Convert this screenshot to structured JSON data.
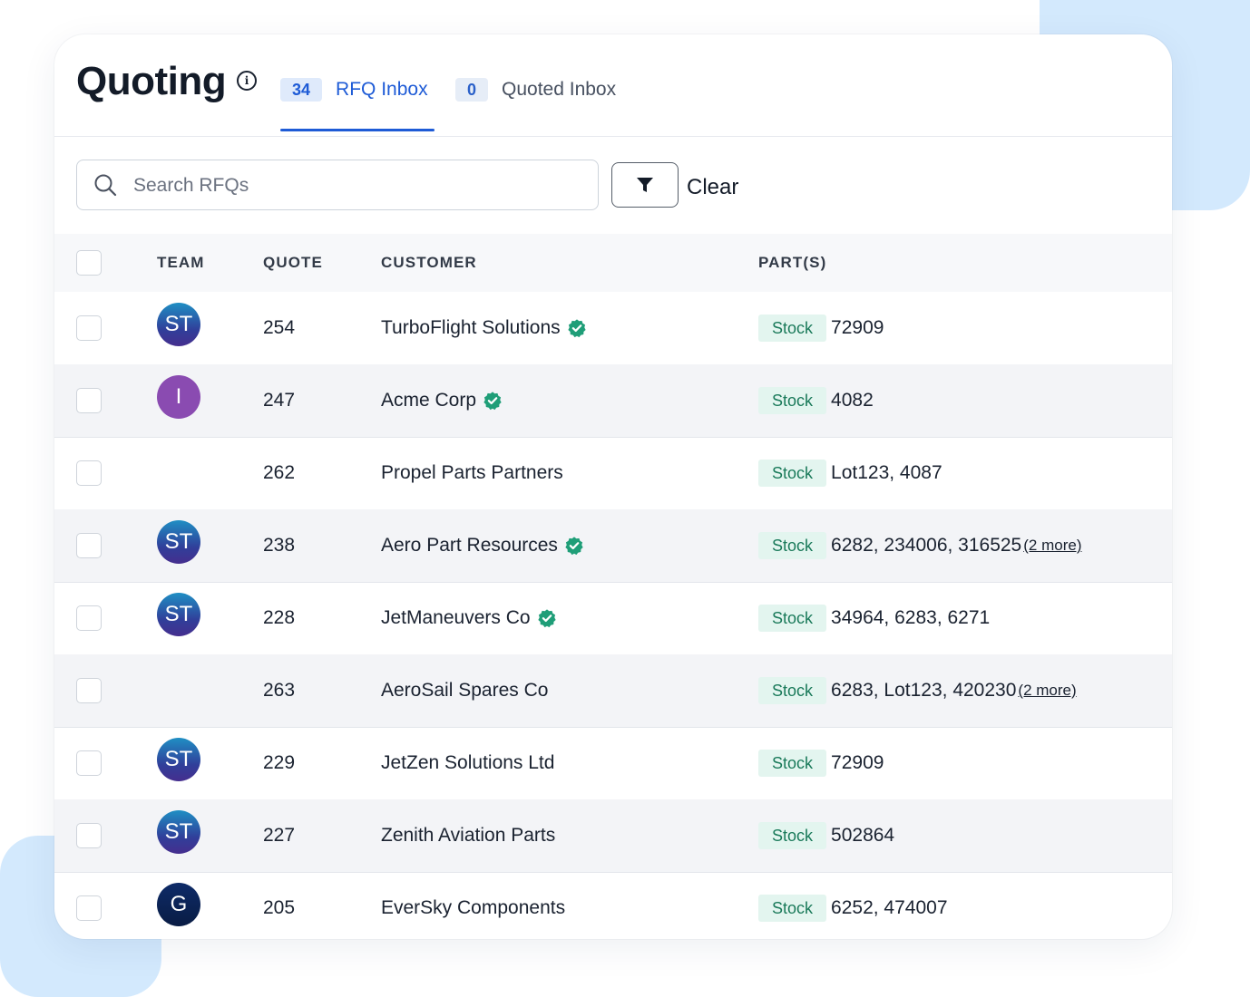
{
  "header": {
    "title": "Quoting",
    "info_icon": "info-icon",
    "tabs": [
      {
        "count": "34",
        "label": "RFQ Inbox",
        "active": true
      },
      {
        "count": "0",
        "label": "Quoted Inbox",
        "active": false
      }
    ]
  },
  "toolbar": {
    "search_placeholder": "Search RFQs",
    "search_icon": "search-icon",
    "filter_icon": "filter-icon",
    "clear_label": "Clear"
  },
  "table": {
    "columns": [
      "TEAM",
      "QUOTE",
      "CUSTOMER",
      "PART(S)"
    ],
    "rows": [
      {
        "team": "ST",
        "avatar": "st",
        "quote": "254",
        "customer": "TurboFlight Solutions",
        "verified": true,
        "tag": "Stock",
        "parts": "72909",
        "more": ""
      },
      {
        "team": "I",
        "avatar": "purple",
        "quote": "247",
        "customer": "Acme Corp",
        "verified": true,
        "tag": "Stock",
        "parts": "4082",
        "more": ""
      },
      {
        "team": "",
        "avatar": "",
        "quote": "262",
        "customer": "Propel Parts Partners",
        "verified": false,
        "tag": "Stock",
        "parts": "Lot123, 4087",
        "more": ""
      },
      {
        "team": "ST",
        "avatar": "st",
        "quote": "238",
        "customer": "Aero Part Resources",
        "verified": true,
        "tag": "Stock",
        "parts": "6282, 234006, 316525",
        "more": "(2 more)"
      },
      {
        "team": "ST",
        "avatar": "st",
        "quote": "228",
        "customer": "JetManeuvers Co",
        "verified": true,
        "tag": "Stock",
        "parts": "34964, 6283, 6271",
        "more": ""
      },
      {
        "team": "",
        "avatar": "",
        "quote": "263",
        "customer": "AeroSail Spares Co",
        "verified": false,
        "tag": "Stock",
        "parts": "6283, Lot123, 420230",
        "more": "(2 more)"
      },
      {
        "team": "ST",
        "avatar": "st",
        "quote": "229",
        "customer": "JetZen Solutions Ltd",
        "verified": false,
        "tag": "Stock",
        "parts": "72909",
        "more": ""
      },
      {
        "team": "ST",
        "avatar": "st",
        "quote": "227",
        "customer": "Zenith Aviation Parts",
        "verified": false,
        "tag": "Stock",
        "parts": "502864",
        "more": ""
      },
      {
        "team": "G",
        "avatar": "navy",
        "quote": "205",
        "customer": "EverSky Components",
        "verified": false,
        "tag": "Stock",
        "parts": "6252, 474007",
        "more": ""
      }
    ]
  },
  "colors": {
    "accent": "#1e5bd6",
    "verified": "#1f9e78",
    "stock_bg": "#e3f5ef",
    "stock_text": "#1a7a5a"
  }
}
